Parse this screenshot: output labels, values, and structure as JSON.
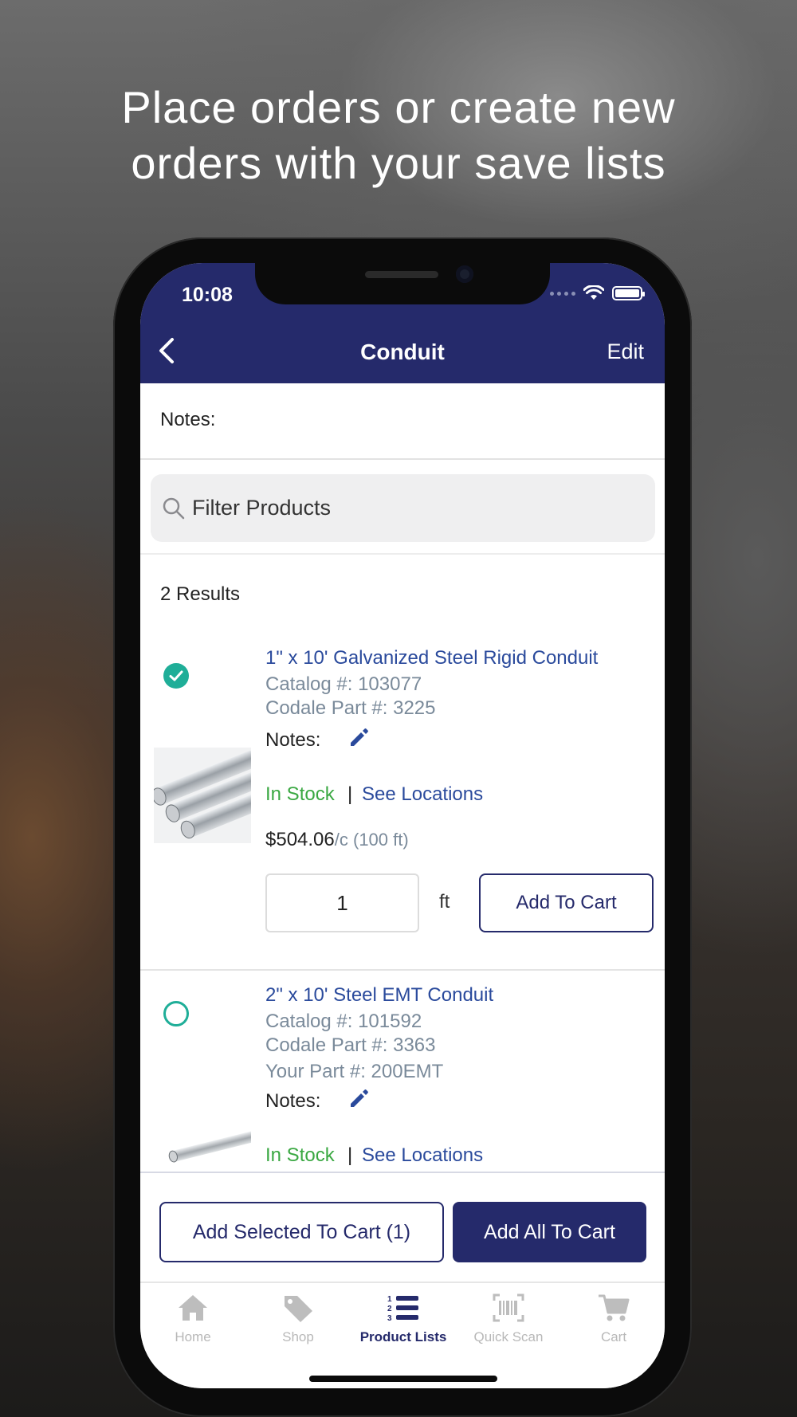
{
  "headline": {
    "line1": "Place orders or create new",
    "line2": "orders with your save lists"
  },
  "status_bar": {
    "time": "10:08"
  },
  "nav": {
    "back_icon": "chevron-left-icon",
    "title": "Conduit",
    "edit_label": "Edit"
  },
  "notes": {
    "label": "Notes:"
  },
  "filter": {
    "placeholder": "Filter Products",
    "icon": "search-icon"
  },
  "results": {
    "label": "2 Results"
  },
  "products": [
    {
      "selected": true,
      "title": "1\" x 10' Galvanized Steel Rigid Conduit",
      "catalog": "Catalog #: 103077",
      "codale_part": "Codale Part #: 3225",
      "notes_label": "Notes:",
      "stock": "In Stock",
      "separator": "|",
      "locations_label": "See Locations",
      "price": "$504.06",
      "price_unit": "/c (100 ft)",
      "quantity": "1",
      "unit": "ft",
      "add_label": "Add To Cart"
    },
    {
      "selected": false,
      "title": "2\" x 10' Steel EMT Conduit",
      "catalog": "Catalog #: 101592",
      "codale_part": "Codale Part #: 3363",
      "your_part": "Your Part #: 200EMT",
      "notes_label": "Notes:",
      "stock": "In Stock",
      "separator": "|",
      "locations_label": "See Locations"
    }
  ],
  "actions": {
    "add_selected_label": "Add Selected To Cart (1)",
    "add_all_label": "Add All To Cart"
  },
  "tabs": [
    {
      "label": "Home",
      "icon": "home-icon",
      "active": false
    },
    {
      "label": "Shop",
      "icon": "tag-icon",
      "active": false
    },
    {
      "label": "Product Lists",
      "icon": "numbered-list-icon",
      "active": true
    },
    {
      "label": "Quick Scan",
      "icon": "barcode-icon",
      "active": false
    },
    {
      "label": "Cart",
      "icon": "cart-icon",
      "active": false
    }
  ],
  "colors": {
    "brand_navy": "#252a6b",
    "link_blue": "#2a4a9c",
    "in_stock_green": "#3aa842",
    "selected_teal": "#1fae98"
  }
}
